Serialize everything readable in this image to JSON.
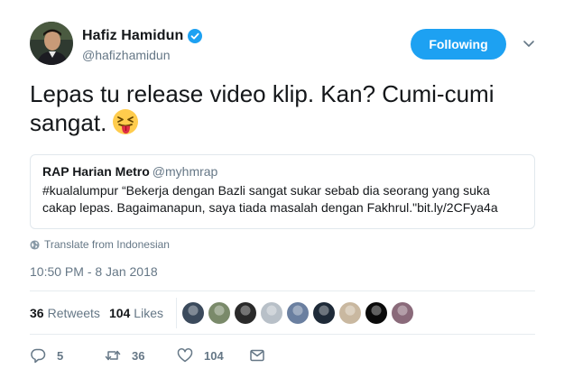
{
  "author": {
    "display_name": "Hafiz Hamidun",
    "handle": "@hafizhamidun",
    "verified": true,
    "avatar_icon": "avatar-photo"
  },
  "follow_button": {
    "label": "Following",
    "color": "#1da1f2"
  },
  "caret_icon": "chevron-down-icon",
  "tweet": {
    "text": "Lepas tu release video klip. Kan? Cumi-cumi sangat.",
    "emoji": "squinting-face-with-tongue"
  },
  "quoted_tweet": {
    "name": "RAP Harian Metro",
    "handle": "@myhmrap",
    "text": "#kualalumpur “Bekerja dengan Bazli sangat sukar sebab dia seorang yang suka cakap lepas. Bagaimanapun, saya tiada masalah dengan Fakhrul.\"bit.ly/2CFya4a"
  },
  "translate": {
    "label": "Translate from Indonesian",
    "icon": "globe-icon"
  },
  "timestamp": "10:50 PM - 8 Jan 2018",
  "stats": {
    "retweets_count": "36",
    "retweets_label": "Retweets",
    "likes_count": "104",
    "likes_label": "Likes"
  },
  "likers": [
    {
      "name": "liker-1",
      "color": "#3b4a5c"
    },
    {
      "name": "liker-2",
      "color": "#7a8a6a"
    },
    {
      "name": "liker-3",
      "color": "#2a2a2a"
    },
    {
      "name": "liker-4",
      "color": "#b8c0c8"
    },
    {
      "name": "liker-5",
      "color": "#6a7fa0"
    },
    {
      "name": "liker-6",
      "color": "#1e2a38"
    },
    {
      "name": "liker-7",
      "color": "#c9b8a0"
    },
    {
      "name": "liker-8",
      "color": "#0a0a0a"
    },
    {
      "name": "liker-9",
      "color": "#8a6a7a"
    }
  ],
  "actions": {
    "reply_count": "5",
    "retweet_count": "36",
    "like_count": "104",
    "reply_icon": "reply-icon",
    "retweet_icon": "retweet-icon",
    "like_icon": "heart-icon",
    "dm_icon": "envelope-icon"
  }
}
